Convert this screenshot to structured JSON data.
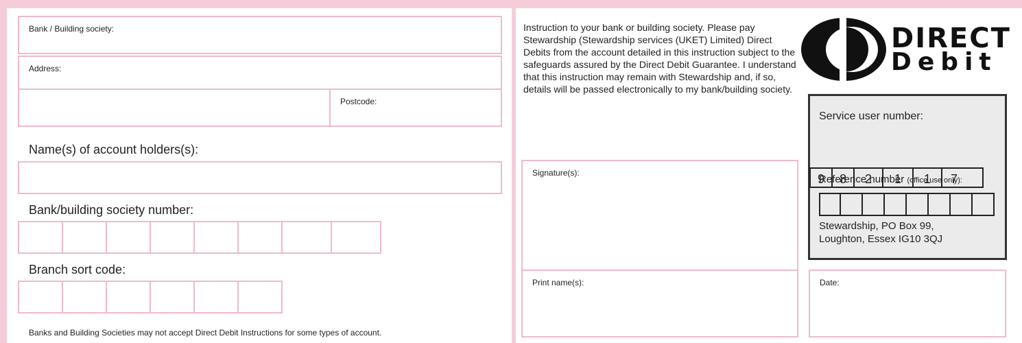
{
  "left": {
    "bank_label": "Bank / Building society:",
    "address_label": "Address:",
    "postcode_label": "Postcode:",
    "names_heading": "Name(s) of account holders(s):",
    "bank_number_heading": "Bank/building society number:",
    "bank_number_cells": 8,
    "sort_code_heading": "Branch sort code:",
    "sort_code_cells": 6,
    "footer_note": "Banks and Building Societies may not accept Direct Debit Instructions for some types of account."
  },
  "right": {
    "instruction": "Instruction to your bank or building society. Please pay Stewardship (Stewardship services (UKET) Limited) Direct Debits from the account detailed in this instruction subject to the safeguards assured by the Direct Debit Guarantee. I understand that this instruction may remain with Stewardship and, if so, details will be passed electronically to my bank/building society.",
    "signature_label": "Signature(s):",
    "print_name_label": "Print name(s):",
    "date_label": "Date:"
  },
  "logo": {
    "line1": "DIRECT",
    "line2": "Debit"
  },
  "service_box": {
    "service_user_label": "Service user number:",
    "service_user_digits": [
      "9",
      "8",
      "2",
      "1",
      "1",
      "7"
    ],
    "reference_label": "Reference number",
    "reference_note": "(office use only):",
    "reference_cells": 8,
    "address_line1": "Stewardship, PO Box 99,",
    "address_line2": "Loughton, Essex IG10 3QJ"
  }
}
